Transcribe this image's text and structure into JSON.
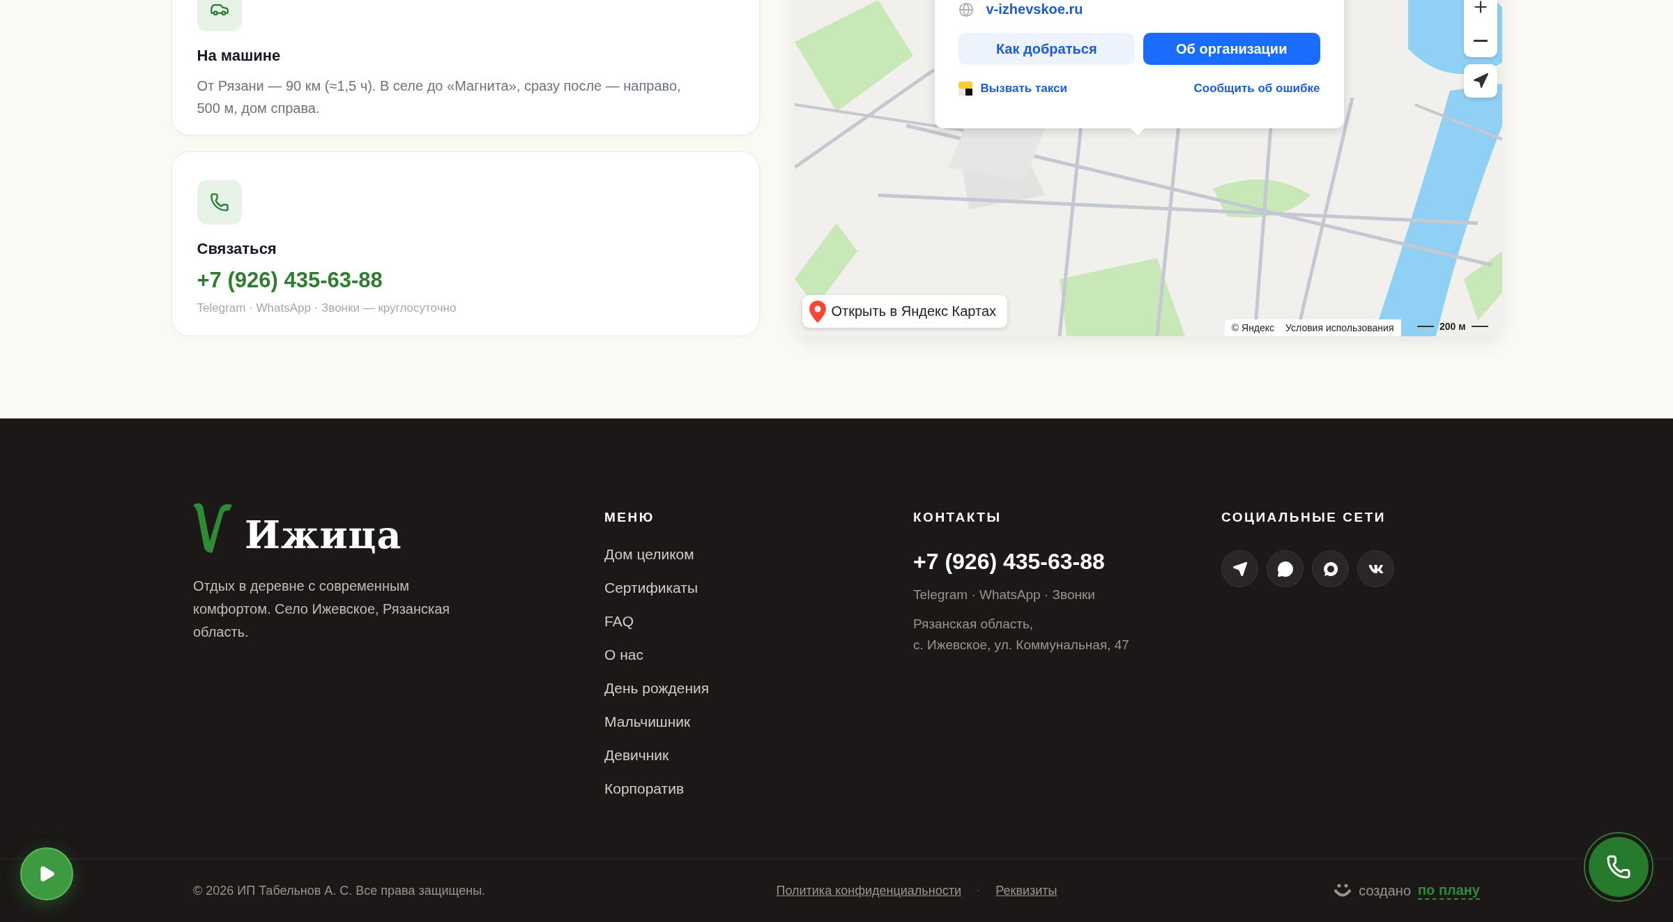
{
  "info_cards": [
    {
      "kind": "route",
      "title": "На машине",
      "text": "От Рязани — 90 км (≈1,5 ч). В селе до «Магнита», сразу после — направо, 500 м, дом справа."
    },
    {
      "kind": "contact",
      "title": "Связаться",
      "phone": "+7 (926) 435-63-88",
      "note": "Telegram · WhatsApp · Звонки — круглосуточно"
    }
  ],
  "map": {
    "kind": "picture",
    "popup": {
      "website": "v-izhevskoe.ru",
      "buttons": [
        {
          "label": "Как добраться",
          "primary": false
        },
        {
          "label": "Об организации",
          "primary": true
        }
      ],
      "taxi_link": "Вызвать такси",
      "report_link": "Сообщить об ошибке"
    },
    "open_button": "Открыть в Яндекс Картах",
    "copyright": "© Яндекс",
    "terms": "Условия использования",
    "scale": "200 м"
  },
  "footer": {
    "brand": {
      "name": "Ижица",
      "description": "Отдых в деревне с современным комфортом. Село Ижевское, Рязанская область."
    },
    "menu": {
      "heading": "МЕНЮ",
      "items": [
        "Дом целиком",
        "Сертификаты",
        "FAQ",
        "О нас",
        "День рождения",
        "Мальчишник",
        "Девичник",
        "Корпоратив"
      ]
    },
    "contacts": {
      "heading": "КОНТАКТЫ",
      "phone": "+7 (926) 435-63-88",
      "channels": "Telegram · WhatsApp · Звонки",
      "address_lines": [
        "Рязанская область,",
        "с. Ижевское, ул. Коммунальная, 47"
      ]
    },
    "social": {
      "heading": "СОЦИАЛЬНЫЕ СЕТИ",
      "links": [
        {
          "kind": "telegram"
        },
        {
          "kind": "chat"
        },
        {
          "kind": "ring"
        },
        {
          "kind": "vk"
        }
      ]
    },
    "copyright": "© 2026 ИП Табельнов А. С. Все права защищены.",
    "legal_links": [
      "Политика конфиденциальности",
      "Реквизиты"
    ],
    "separator": "·",
    "credit": {
      "text": "создано",
      "link": "по плану"
    }
  }
}
